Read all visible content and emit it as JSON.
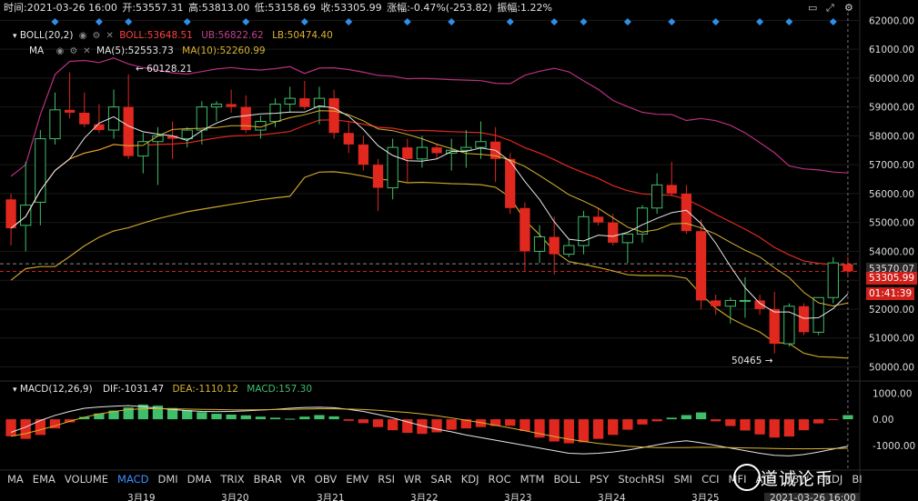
{
  "header": {
    "time_label": "时间:2021-03-26 16:00",
    "open_label": "开:53557.31",
    "high_label": "高:53813.00",
    "low_label": "低:53158.69",
    "close_label": "收:53305.99",
    "change_label": "涨幅:-0.47%(-253.82)",
    "amplitude_label": "振幅:1.22%"
  },
  "boll_legend": {
    "name": "BOLL(20,2)",
    "boll": "BOLL:53648.51",
    "ub": "UB:56822.62",
    "lb": "LB:50474.40"
  },
  "ma_legend": {
    "name": "MA",
    "ma5": "MA(5):52553.73",
    "ma10": "MA(10):52260.99"
  },
  "macd_legend": {
    "name": "MACD(12,26,9)",
    "dif": "DIF:-1031.47",
    "dea": "DEA:-1110.12",
    "macd": "MACD:157.30"
  },
  "annotations": {
    "high": "← 60128.21",
    "low": "50465 →"
  },
  "price_tags": {
    "last": "53570.07",
    "close": "53305.99",
    "countdown": "01:41:39"
  },
  "indicator_tabs": [
    "MA",
    "EMA",
    "VOLUME",
    "MACD",
    "DMI",
    "DMA",
    "TRIX",
    "BRAR",
    "VR",
    "OBV",
    "EMV",
    "RSI",
    "WR",
    "SAR",
    "KDJ",
    "ROC",
    "MTM",
    "BOLL",
    "PSY",
    "StochRSI",
    "SMI",
    "CCI",
    "MFI",
    "ATR",
    "BBW",
    "SKDJ",
    "BI"
  ],
  "active_tab": "MACD",
  "x_axis_labels": [
    "3月19",
    "3月20",
    "3月21",
    "3月22",
    "3月23",
    "3月24",
    "3月25",
    "2021-03-26 16:00"
  ],
  "watermark": "道诚论币",
  "colors": {
    "up": "#3fbf6a",
    "down": "#e0281f",
    "ma5": "#e6e6e6",
    "ma10": "#d9b330",
    "boll": "#e0281f",
    "ub": "#b8307f",
    "lb": "#c9a22a"
  },
  "chart_data": [
    {
      "type": "candlestick",
      "title": "",
      "ylim": [
        49700,
        62200
      ],
      "y_ticks": [
        "62000.00",
        "61000.00",
        "60000.00",
        "59000.00",
        "58000.00",
        "57000.00",
        "56000.00",
        "55000.00",
        "54000.00",
        "53000.00",
        "52000.00",
        "51000.00",
        "50000.00"
      ],
      "candles": [
        [
          55800,
          56000,
          54200,
          54800
        ],
        [
          54900,
          57100,
          54000,
          55600
        ],
        [
          55700,
          58200,
          54900,
          57900
        ],
        [
          57900,
          59500,
          57700,
          58900
        ],
        [
          58900,
          60200,
          58600,
          58800
        ],
        [
          58800,
          59500,
          58300,
          58400
        ],
        [
          58400,
          59100,
          58100,
          58200
        ],
        [
          58200,
          59600,
          57900,
          59000
        ],
        [
          59000,
          60128.21,
          57200,
          57300
        ],
        [
          57300,
          58100,
          56700,
          57800
        ],
        [
          57800,
          58300,
          56300,
          58000
        ],
        [
          58000,
          58500,
          57200,
          57900
        ],
        [
          57900,
          58300,
          57600,
          58200
        ],
        [
          58200,
          59200,
          57700,
          59000
        ],
        [
          59000,
          59200,
          58500,
          59100
        ],
        [
          59100,
          59600,
          58800,
          59000
        ],
        [
          59000,
          59400,
          58100,
          58200
        ],
        [
          58200,
          58700,
          57900,
          58500
        ],
        [
          58500,
          59300,
          58300,
          59100
        ],
        [
          59100,
          59700,
          58800,
          59300
        ],
        [
          59300,
          59900,
          58900,
          59000
        ],
        [
          59000,
          59700,
          58400,
          59300
        ],
        [
          59300,
          59600,
          57900,
          58100
        ],
        [
          58100,
          58500,
          57400,
          57700
        ],
        [
          57700,
          58000,
          56800,
          57000
        ],
        [
          57000,
          57200,
          55400,
          56200
        ],
        [
          56200,
          57900,
          55800,
          57600
        ],
        [
          57600,
          57900,
          56400,
          57200
        ],
        [
          57200,
          58000,
          56900,
          57600
        ],
        [
          57600,
          57700,
          57200,
          57400
        ],
        [
          57400,
          57900,
          56800,
          57500
        ],
        [
          57500,
          58200,
          56900,
          57600
        ],
        [
          57600,
          58500,
          57200,
          57800
        ],
        [
          57800,
          58300,
          56400,
          57200
        ],
        [
          57200,
          57400,
          55300,
          55500
        ],
        [
          55500,
          55700,
          53300,
          54000
        ],
        [
          54000,
          54900,
          53600,
          54500
        ],
        [
          54500,
          55200,
          53200,
          53900
        ],
        [
          53900,
          54400,
          53800,
          54200
        ],
        [
          54200,
          55400,
          53900,
          55200
        ],
        [
          55200,
          55500,
          54900,
          55000
        ],
        [
          55000,
          55300,
          54200,
          54300
        ],
        [
          54300,
          54500,
          53600,
          54600
        ],
        [
          54600,
          55600,
          54300,
          55500
        ],
        [
          55500,
          56700,
          55300,
          56300
        ],
        [
          56300,
          57100,
          55900,
          56000
        ],
        [
          56000,
          56300,
          54600,
          54700
        ],
        [
          54700,
          55100,
          52000,
          52300
        ],
        [
          52300,
          52500,
          51800,
          52100
        ],
        [
          52100,
          52400,
          51500,
          52300
        ],
        [
          52300,
          53100,
          51700,
          52300
        ],
        [
          52300,
          52500,
          51800,
          52000
        ],
        [
          52000,
          52600,
          50465,
          50800
        ],
        [
          50800,
          52200,
          50700,
          52100
        ],
        [
          52100,
          52200,
          51100,
          51200
        ],
        [
          51200,
          52400,
          51100,
          52400
        ],
        [
          52400,
          53800,
          52200,
          53600
        ],
        [
          53557.31,
          53813,
          53158.69,
          53305.99
        ]
      ]
    },
    {
      "type": "bar",
      "title": "MACD(12,26,9)",
      "ylim": [
        -1700,
        1150
      ],
      "y_ticks": [
        "1000.00",
        "0.00",
        "-1000.00"
      ],
      "series": [
        {
          "name": "MACD",
          "values": [
            -650,
            -750,
            -600,
            -350,
            -120,
            90,
            220,
            330,
            450,
            560,
            520,
            430,
            350,
            270,
            210,
            180,
            150,
            100,
            60,
            20,
            100,
            160,
            110,
            -60,
            -150,
            -300,
            -420,
            -520,
            -560,
            -500,
            -400,
            -350,
            -300,
            -260,
            -250,
            -450,
            -700,
            -850,
            -920,
            -880,
            -750,
            -600,
            -400,
            -200,
            -80,
            60,
            160,
            260,
            -80,
            -260,
            -430,
            -580,
            -700,
            -660,
            -420,
            -160,
            -20,
            157.3
          ]
        },
        {
          "name": "DIF",
          "values": [
            -500,
            -300,
            -50,
            150,
            300,
            420,
            470,
            500,
            520,
            480,
            420,
            370,
            330,
            300,
            290,
            300,
            320,
            350,
            380,
            420,
            450,
            460,
            440,
            380,
            300,
            180,
            50,
            -100,
            -250,
            -380,
            -480,
            -600,
            -700,
            -800,
            -900,
            -1000,
            -1100,
            -1200,
            -1300,
            -1320,
            -1300,
            -1250,
            -1180,
            -1080,
            -980,
            -880,
            -820,
            -900,
            -1000,
            -1100,
            -1200,
            -1300,
            -1380,
            -1400,
            -1350,
            -1250,
            -1140,
            -1031.47
          ]
        },
        {
          "name": "DEA",
          "values": [
            -650,
            -550,
            -400,
            -250,
            -80,
            80,
            200,
            290,
            370,
            400,
            410,
            400,
            390,
            380,
            370,
            360,
            360,
            365,
            370,
            380,
            390,
            400,
            400,
            390,
            370,
            340,
            300,
            260,
            200,
            130,
            50,
            -40,
            -130,
            -230,
            -330,
            -440,
            -550,
            -660,
            -760,
            -850,
            -920,
            -980,
            -1030,
            -1060,
            -1080,
            -1080,
            -1080,
            -1070,
            -1075,
            -1085,
            -1095,
            -1105,
            -1115,
            -1125,
            -1130,
            -1125,
            -1118,
            -1110.12
          ]
        }
      ]
    }
  ]
}
